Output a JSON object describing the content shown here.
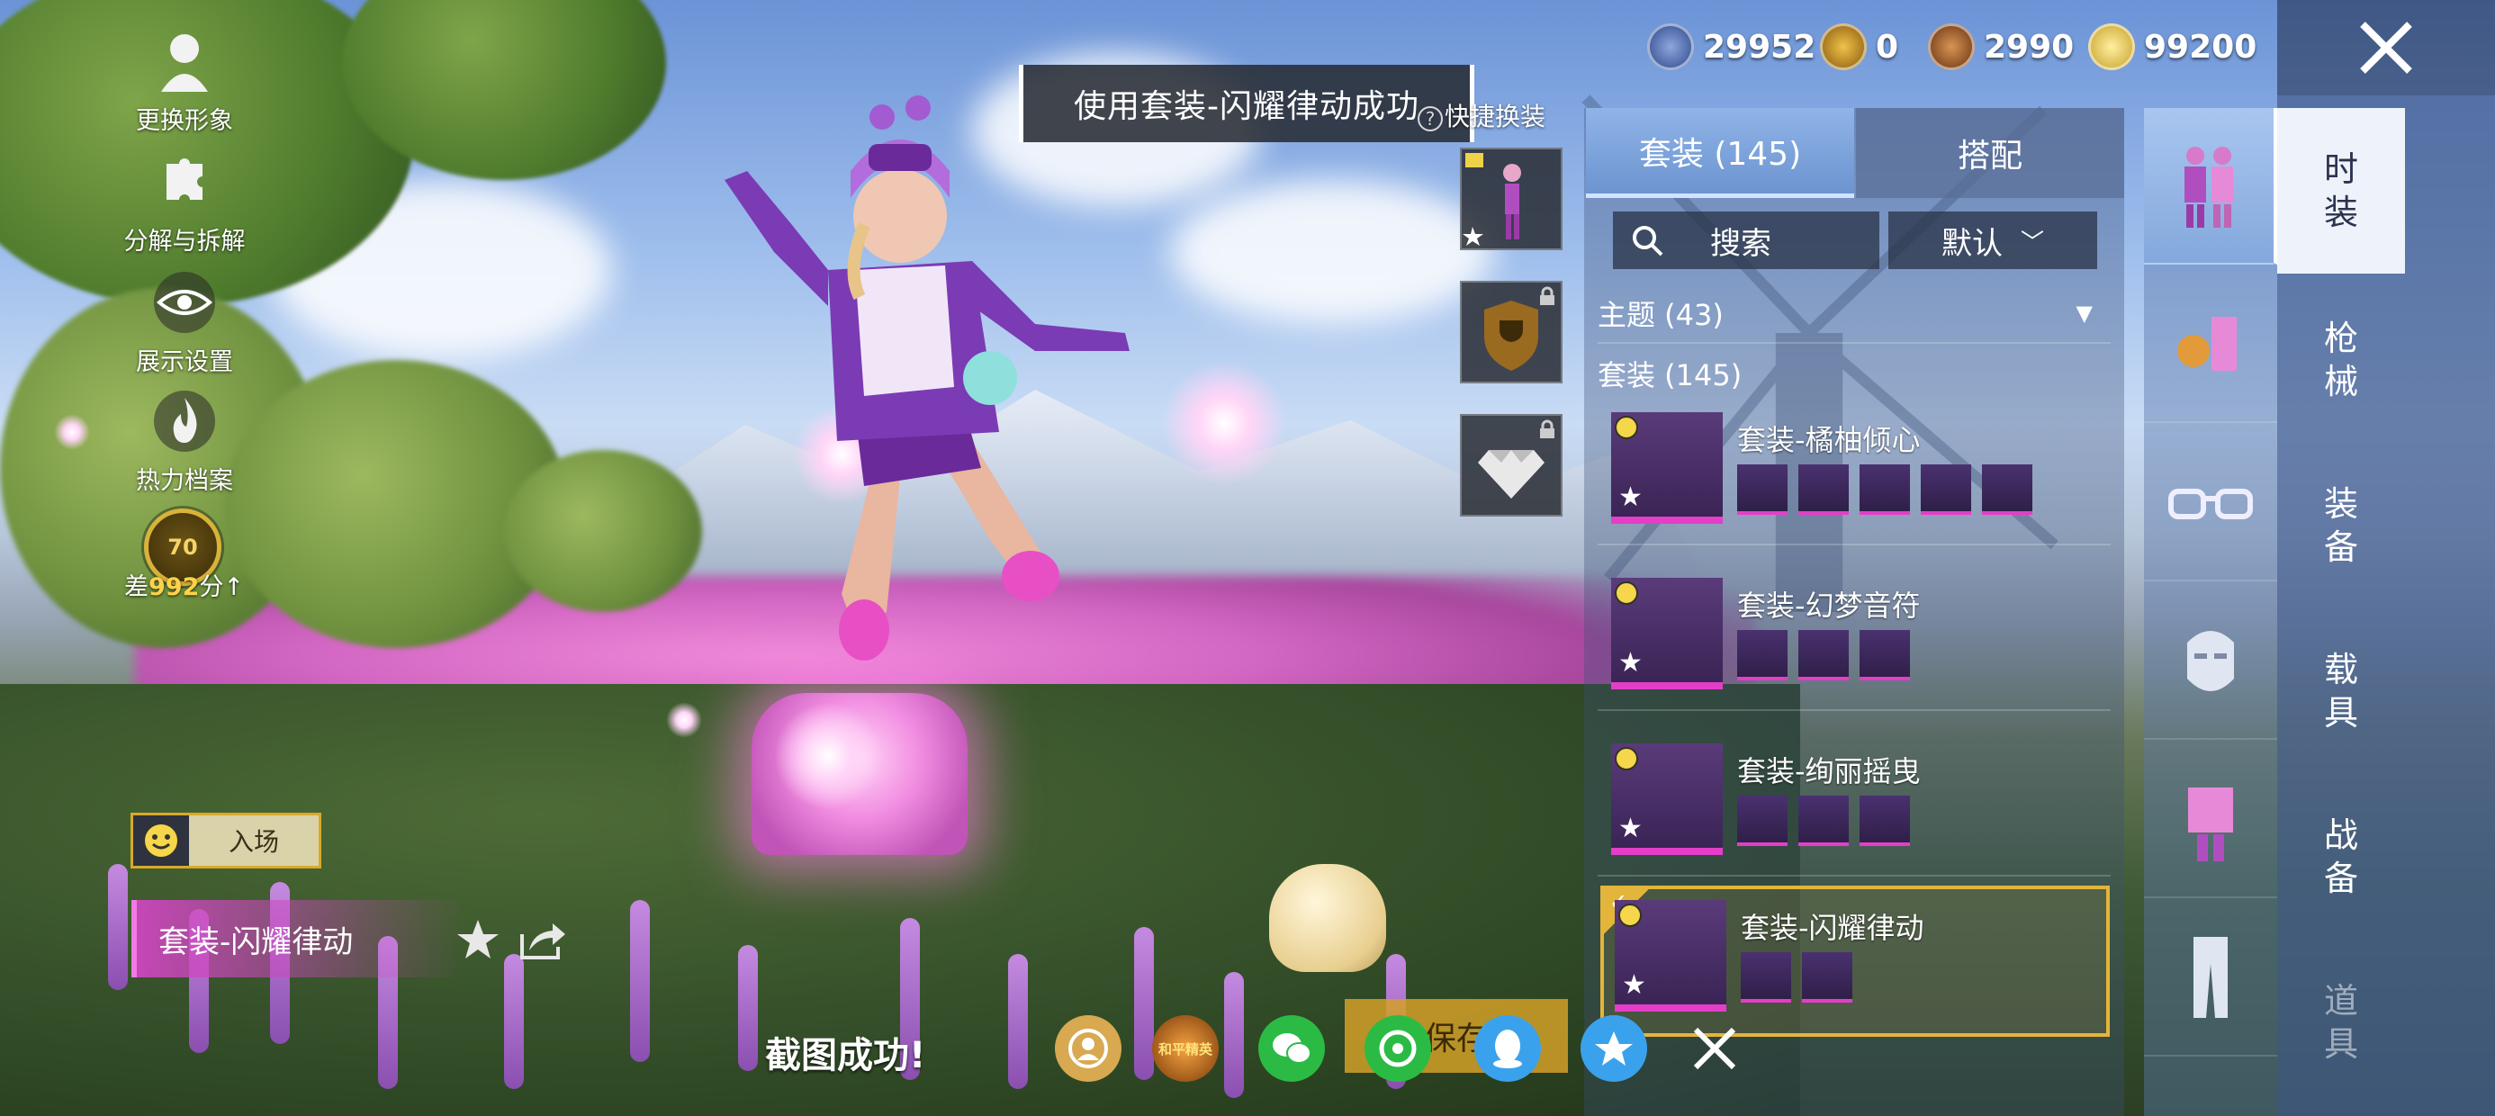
{
  "left_tools": [
    {
      "label": "更换形象"
    },
    {
      "label": "分解与拆解"
    },
    {
      "label": "展示设置"
    },
    {
      "label": "热力档案"
    }
  ],
  "rank": {
    "level": "70",
    "prefix": "差",
    "value": "992",
    "suffix": "分↑"
  },
  "entry": {
    "label": "入场"
  },
  "current_outfit": {
    "name": "套装-闪耀律动"
  },
  "toast": {
    "text": "使用套装-闪耀律动成功"
  },
  "quick_change": {
    "title": "快捷换装",
    "help": "?"
  },
  "currencies": [
    {
      "value": "29952",
      "color": "#3b4f8a"
    },
    {
      "value": "0",
      "color": "#b8861e"
    },
    {
      "value": "2990",
      "color": "#9a5b24"
    },
    {
      "value": "99200",
      "color": "#d9b52a"
    }
  ],
  "wardrobe": {
    "tabs": [
      {
        "label": "套装 (145)"
      },
      {
        "label": "搭配"
      }
    ],
    "search_label": "搜索",
    "sort_label": "默认",
    "theme_label": "主题 (43)",
    "suit_head": "套装 (145)",
    "suits": [
      {
        "name": "套装-橘柚倾心",
        "parts": 5
      },
      {
        "name": "套装-幻梦音符",
        "parts": 3
      },
      {
        "name": "套装-绚丽摇曳",
        "parts": 3
      },
      {
        "name": "套装-闪耀律动",
        "parts": 2
      }
    ]
  },
  "side_nav": [
    {
      "label": "时装"
    },
    {
      "label": "枪械"
    },
    {
      "label": "装备"
    },
    {
      "label": "载具"
    },
    {
      "label": "战备"
    },
    {
      "label": "道具"
    }
  ],
  "share_bar": {
    "screenshot_text": "截图成功!",
    "save_label": "保存",
    "icons": [
      "friend-share-icon",
      "game-brand-icon",
      "wechat-icon",
      "moments-icon",
      "qq-icon",
      "qzone-icon"
    ],
    "brand_text": "和平精英"
  }
}
